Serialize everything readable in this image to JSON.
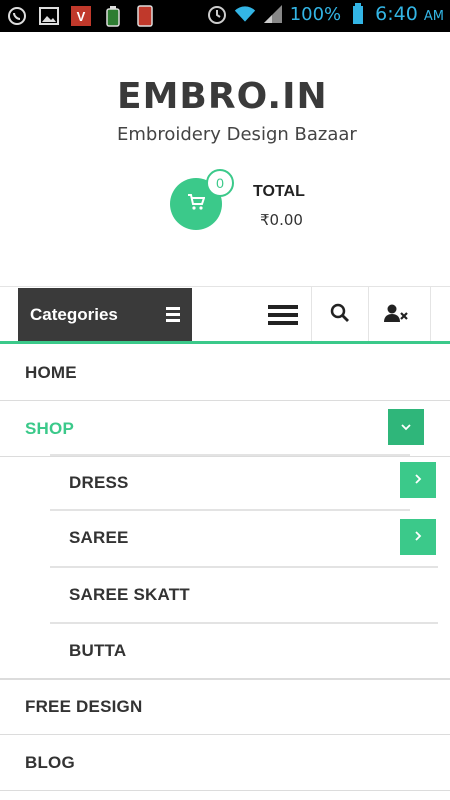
{
  "status_bar": {
    "battery_percent": "100%",
    "time": "6:40",
    "ampm": "AM",
    "icons": [
      "whatsapp-icon",
      "gallery-icon",
      "vivo-icon",
      "battery-saver-icon",
      "phone-app-icon"
    ],
    "right_icons": [
      "alarm-icon",
      "wifi-icon",
      "signal-icon",
      "battery-icon"
    ],
    "color": "#33b5e5"
  },
  "header": {
    "title": "EMBRO.IN",
    "subtitle": "Embroidery Design Bazaar"
  },
  "cart": {
    "count": "0",
    "total_label": "TOTAL",
    "total_value": "₹0.00",
    "icon": "cart-icon"
  },
  "nav": {
    "categories_label": "Categories",
    "menu_icon": "hamburger-icon",
    "search_icon": "search-icon",
    "account_icon": "user-icon"
  },
  "menu": {
    "items": [
      {
        "label": "HOME"
      },
      {
        "label": "SHOP"
      },
      {
        "label": "DRESS"
      },
      {
        "label": "SAREE"
      },
      {
        "label": "SAREE SKATT"
      },
      {
        "label": "BUTTA"
      },
      {
        "label": "FREE DESIGN"
      },
      {
        "label": "BLOG"
      }
    ]
  },
  "colors": {
    "accent": "#3bc98a",
    "dark": "#3a3a3a"
  }
}
